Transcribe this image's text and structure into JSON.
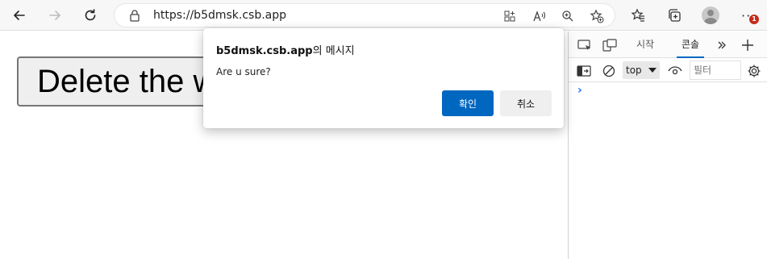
{
  "browser": {
    "url": "https://b5dmsk.csb.app",
    "notification_count": "1",
    "icons": {
      "back": "back-arrow-icon",
      "forward": "forward-arrow-icon",
      "refresh": "refresh-icon",
      "lock": "lock-icon",
      "apps": "app-available-icon",
      "read_aloud": "read-aloud-icon",
      "zoom": "zoom-icon",
      "add_favorite": "add-favorite-icon",
      "favorites": "favorites-icon",
      "collections": "collections-icon",
      "profile": "profile-avatar",
      "more": "more-menu-icon"
    }
  },
  "page": {
    "button_label": "Delete the w"
  },
  "devtools": {
    "tabs": [
      {
        "label": "시작",
        "active": false
      },
      {
        "label": "콘솔",
        "active": true
      }
    ],
    "context_select": "top",
    "filter_placeholder": "필터",
    "accent_color": "#0067c0"
  },
  "dialog": {
    "origin": "b5dmsk.csb.app",
    "title_suffix": "의 메시지",
    "message": "Are u sure?",
    "ok_label": "확인",
    "cancel_label": "취소"
  }
}
